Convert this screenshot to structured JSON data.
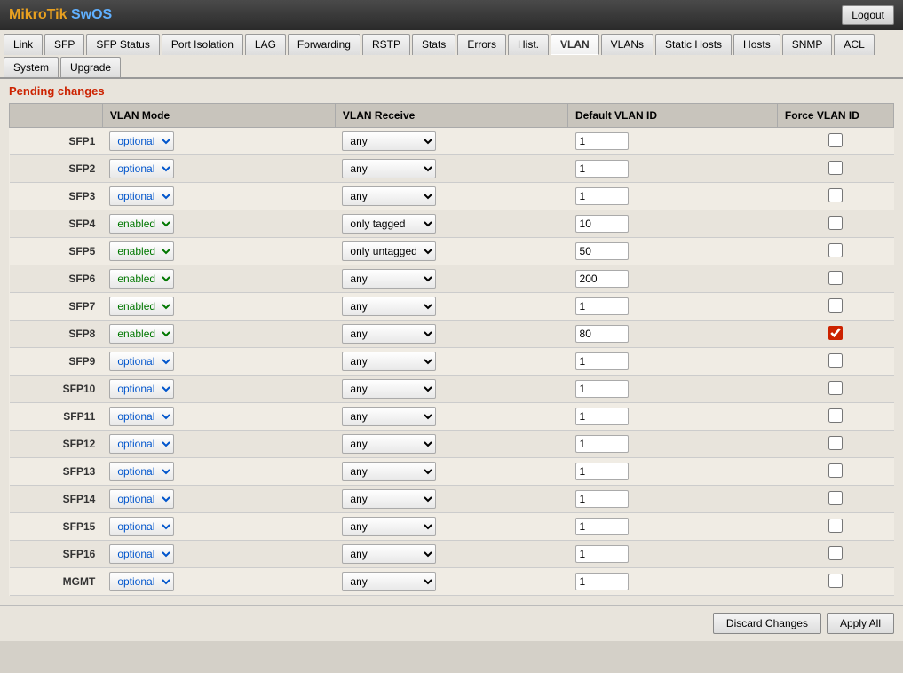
{
  "header": {
    "title_mikro": "MikroTik",
    "title_swos": "SwOS",
    "logout_label": "Logout"
  },
  "tabs": [
    {
      "label": "Link",
      "active": false
    },
    {
      "label": "SFP",
      "active": false
    },
    {
      "label": "SFP Status",
      "active": false
    },
    {
      "label": "Port Isolation",
      "active": false
    },
    {
      "label": "LAG",
      "active": false
    },
    {
      "label": "Forwarding",
      "active": false
    },
    {
      "label": "RSTP",
      "active": false
    },
    {
      "label": "Stats",
      "active": false
    },
    {
      "label": "Errors",
      "active": false
    },
    {
      "label": "Hist.",
      "active": false
    },
    {
      "label": "VLAN",
      "active": true
    },
    {
      "label": "VLANs",
      "active": false
    },
    {
      "label": "Static Hosts",
      "active": false
    },
    {
      "label": "Hosts",
      "active": false
    },
    {
      "label": "SNMP",
      "active": false
    },
    {
      "label": "ACL",
      "active": false
    },
    {
      "label": "System",
      "active": false
    },
    {
      "label": "Upgrade",
      "active": false
    }
  ],
  "pending_changes": "Pending changes",
  "table": {
    "headers": [
      "",
      "VLAN Mode",
      "VLAN Receive",
      "Default VLAN ID",
      "Force VLAN ID"
    ],
    "rows": [
      {
        "port": "SFP1",
        "vlan_mode": "optional",
        "vlan_mode_type": "optional",
        "vlan_receive": "any",
        "default_vlan_id": "1",
        "force_vlan": false
      },
      {
        "port": "SFP2",
        "vlan_mode": "optional",
        "vlan_mode_type": "optional",
        "vlan_receive": "any",
        "default_vlan_id": "1",
        "force_vlan": false
      },
      {
        "port": "SFP3",
        "vlan_mode": "optional",
        "vlan_mode_type": "optional",
        "vlan_receive": "any",
        "default_vlan_id": "1",
        "force_vlan": false
      },
      {
        "port": "SFP4",
        "vlan_mode": "enabled",
        "vlan_mode_type": "enabled",
        "vlan_receive": "only tagged",
        "default_vlan_id": "10",
        "force_vlan": false
      },
      {
        "port": "SFP5",
        "vlan_mode": "enabled",
        "vlan_mode_type": "enabled",
        "vlan_receive": "only untagged",
        "default_vlan_id": "50",
        "force_vlan": false
      },
      {
        "port": "SFP6",
        "vlan_mode": "enabled",
        "vlan_mode_type": "enabled",
        "vlan_receive": "any",
        "default_vlan_id": "200",
        "force_vlan": false
      },
      {
        "port": "SFP7",
        "vlan_mode": "enabled",
        "vlan_mode_type": "enabled",
        "vlan_receive": "any",
        "default_vlan_id": "1",
        "force_vlan": false
      },
      {
        "port": "SFP8",
        "vlan_mode": "enabled",
        "vlan_mode_type": "enabled",
        "vlan_receive": "any",
        "default_vlan_id": "80",
        "force_vlan": true
      },
      {
        "port": "SFP9",
        "vlan_mode": "optional",
        "vlan_mode_type": "optional",
        "vlan_receive": "any",
        "default_vlan_id": "1",
        "force_vlan": false
      },
      {
        "port": "SFP10",
        "vlan_mode": "optional",
        "vlan_mode_type": "optional",
        "vlan_receive": "any",
        "default_vlan_id": "1",
        "force_vlan": false
      },
      {
        "port": "SFP11",
        "vlan_mode": "optional",
        "vlan_mode_type": "optional",
        "vlan_receive": "any",
        "default_vlan_id": "1",
        "force_vlan": false
      },
      {
        "port": "SFP12",
        "vlan_mode": "optional",
        "vlan_mode_type": "optional",
        "vlan_receive": "any",
        "default_vlan_id": "1",
        "force_vlan": false
      },
      {
        "port": "SFP13",
        "vlan_mode": "optional",
        "vlan_mode_type": "optional",
        "vlan_receive": "any",
        "default_vlan_id": "1",
        "force_vlan": false
      },
      {
        "port": "SFP14",
        "vlan_mode": "optional",
        "vlan_mode_type": "optional",
        "vlan_receive": "any",
        "default_vlan_id": "1",
        "force_vlan": false
      },
      {
        "port": "SFP15",
        "vlan_mode": "optional",
        "vlan_mode_type": "optional",
        "vlan_receive": "any",
        "default_vlan_id": "1",
        "force_vlan": false
      },
      {
        "port": "SFP16",
        "vlan_mode": "optional",
        "vlan_mode_type": "optional",
        "vlan_receive": "any",
        "default_vlan_id": "1",
        "force_vlan": false
      },
      {
        "port": "MGMT",
        "vlan_mode": "optional",
        "vlan_mode_type": "optional",
        "vlan_receive": "any",
        "default_vlan_id": "1",
        "force_vlan": false
      }
    ]
  },
  "footer": {
    "discard_label": "Discard Changes",
    "apply_label": "Apply All"
  }
}
